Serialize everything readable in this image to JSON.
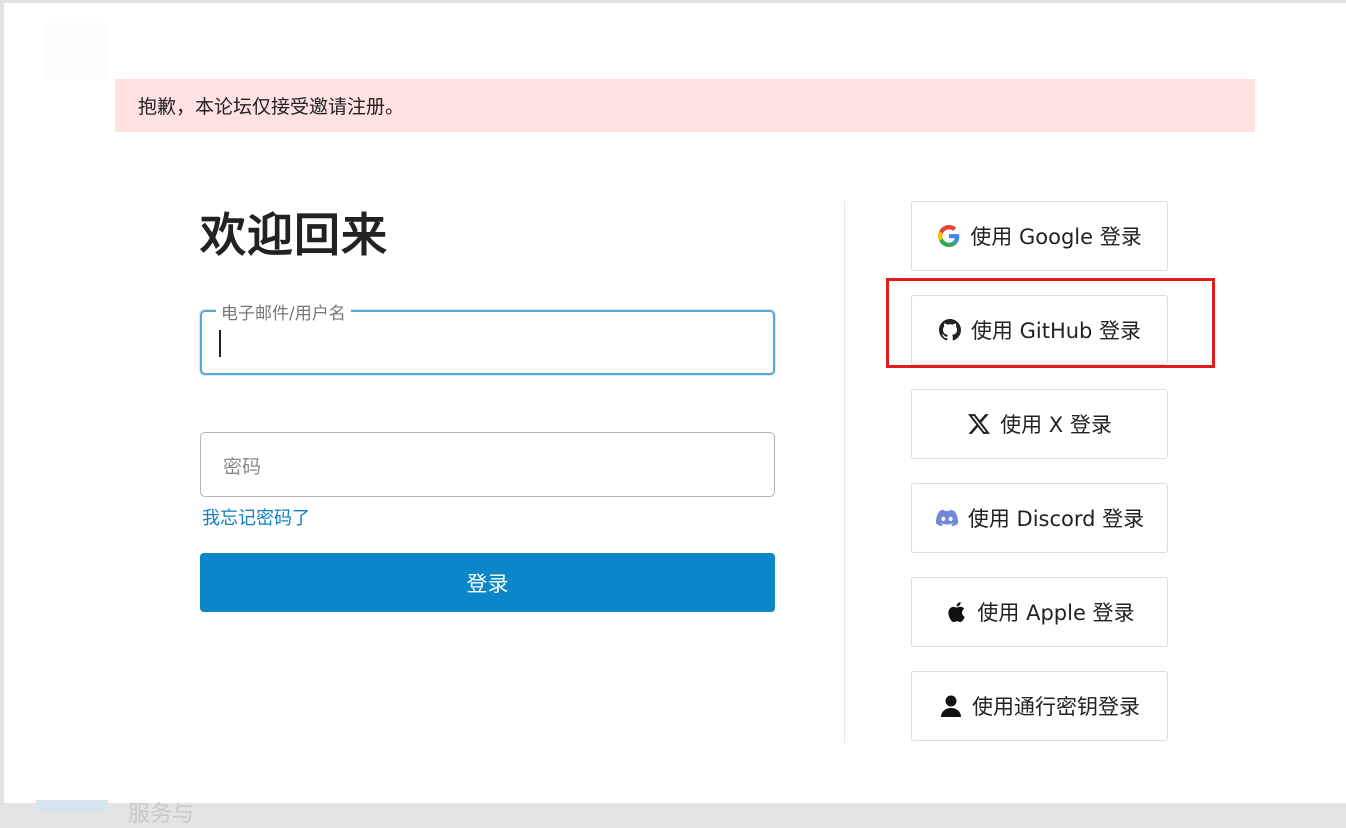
{
  "alert": {
    "text": "抱歉，本论坛仅接受邀请注册。"
  },
  "login": {
    "title": "欢迎回来",
    "username_label": "电子邮件/用户名",
    "username_value": "",
    "password_placeholder": "密码",
    "forgot_password": "我忘记密码了",
    "submit": "登录"
  },
  "social": [
    {
      "label": "使用 Google 登录",
      "icon": "google-icon"
    },
    {
      "label": "使用 GitHub 登录",
      "icon": "github-icon"
    },
    {
      "label": "使用 X 登录",
      "icon": "x-icon"
    },
    {
      "label": "使用 Discord 登录",
      "icon": "discord-icon"
    },
    {
      "label": "使用 Apple 登录",
      "icon": "apple-icon"
    },
    {
      "label": "使用通行密钥登录",
      "icon": "user-icon"
    }
  ],
  "background": {
    "partial_text": "服务与"
  },
  "colors": {
    "alert_bg": "#ffe1e1",
    "primary": "#0a86c9",
    "link": "#0f7fc0",
    "highlight": "#e21b1b",
    "focus_border": "#5aa6d8"
  }
}
